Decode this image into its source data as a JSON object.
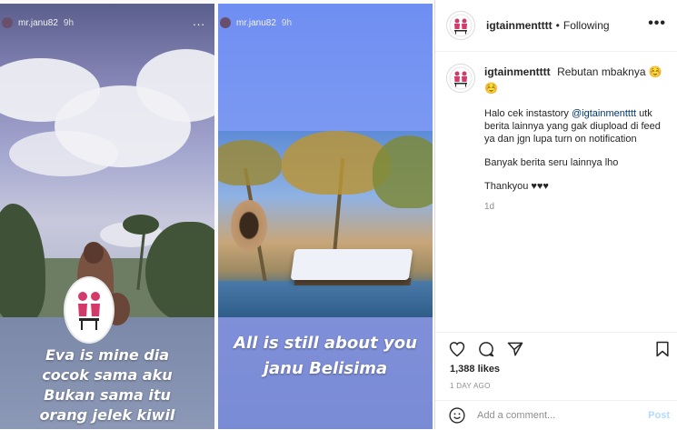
{
  "story_left": {
    "username": "mr.janu82",
    "time": "9h",
    "more": "...",
    "caption_lines": [
      "Eva is mine dia",
      "cocok sama aku",
      "Bukan sama itu",
      "orang jelek kiwil"
    ]
  },
  "story_right": {
    "username": "mr.janu82",
    "time": "9h",
    "caption_lines": [
      "All is still about you",
      "janu Belisima"
    ]
  },
  "header": {
    "username": "igtainmentttt",
    "separator": "•",
    "follow_status": "Following",
    "more": "•••"
  },
  "post_caption": {
    "username": "igtainmentttt",
    "title": "Rebutan mbaknya ☺️☺️",
    "para1_prefix": "Halo cek instastory ",
    "para1_mention": "@igtainmentttt",
    "para1_suffix": " utk berita lainnya yang gak diupload di feed ya dan jgn lupa turn on notification",
    "para2": "Banyak berita seru lainnya lho",
    "para3": "Thankyou ♥♥♥",
    "time": "1d"
  },
  "actions": {
    "icons": [
      "heart-icon",
      "comment-icon",
      "share-icon",
      "bookmark-icon"
    ]
  },
  "likes": "1,388 likes",
  "date": "1 DAY AGO",
  "comment_box": {
    "placeholder": "Add a comment...",
    "post_label": "Post"
  }
}
